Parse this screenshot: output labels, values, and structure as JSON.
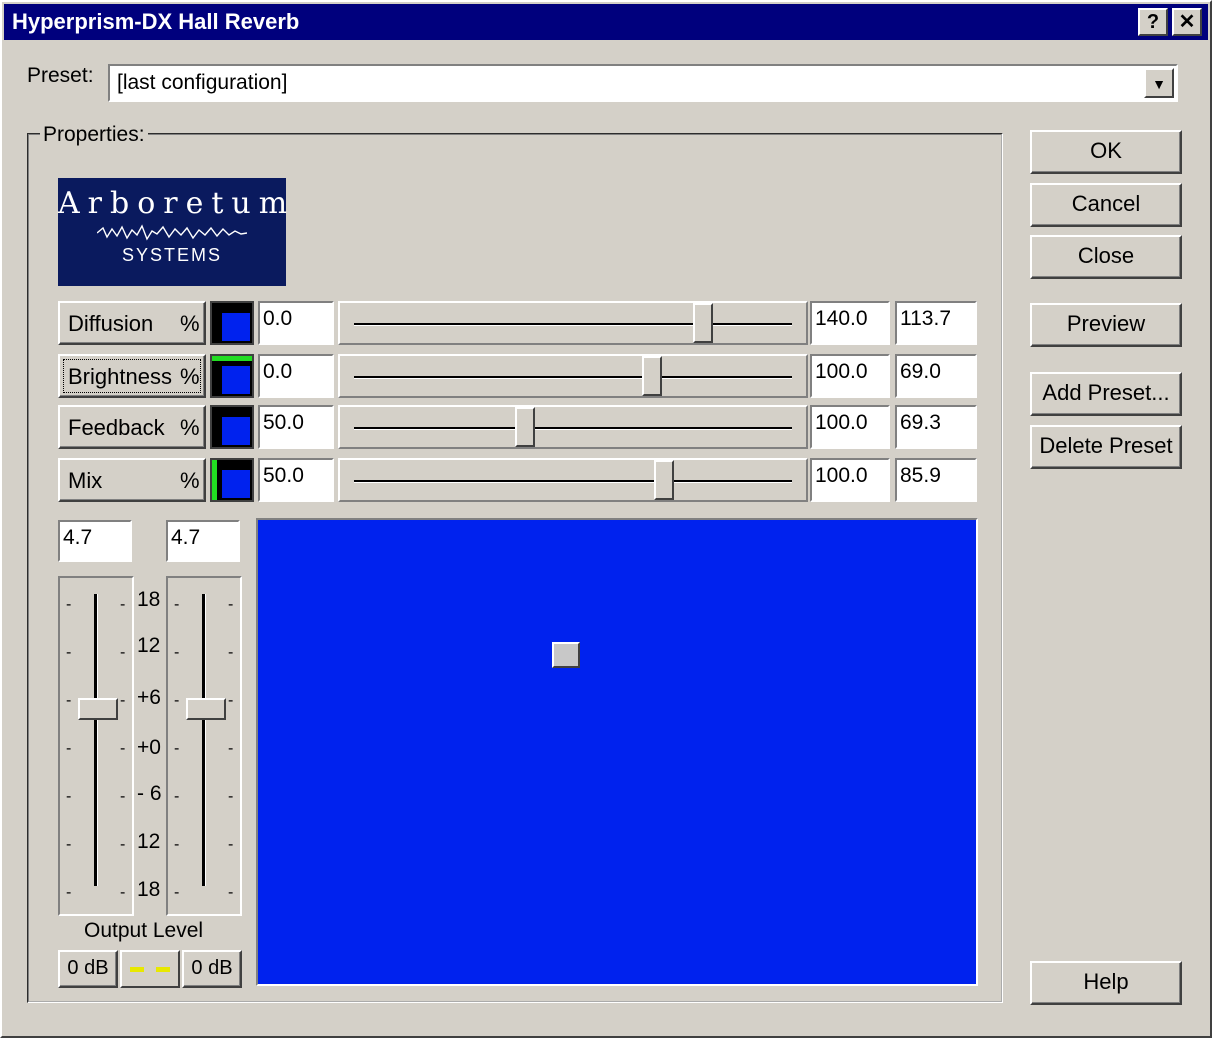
{
  "window": {
    "title": "Hyperprism-DX  Hall Reverb",
    "help_glyph": "?",
    "close_glyph": "✕"
  },
  "preset": {
    "label": "Preset:",
    "value": "[last configuration]"
  },
  "properties": {
    "label": "Properties:"
  },
  "logo": {
    "name": "Arboretum",
    "sub": "SYSTEMS"
  },
  "buttons": {
    "ok": "OK",
    "cancel": "Cancel",
    "close": "Close",
    "preview": "Preview",
    "add_preset": "Add Preset...",
    "delete_preset": "Delete Preset",
    "help": "Help"
  },
  "params": [
    {
      "name": "Diffusion",
      "unit": "%",
      "min": "0.0",
      "max": "140.0",
      "value": "113.7",
      "fraction": 0.81
    },
    {
      "name": "Brightness",
      "unit": "%",
      "min": "0.0",
      "max": "100.0",
      "value": "69.0",
      "fraction": 0.69
    },
    {
      "name": "Feedback",
      "unit": "%",
      "min": "50.0",
      "max": "100.0",
      "value": "69.3",
      "fraction": 0.386
    },
    {
      "name": "Mix",
      "unit": "%",
      "min": "50.0",
      "max": "100.0",
      "value": "85.9",
      "fraction": 0.718
    }
  ],
  "output": {
    "left_value": "4.7",
    "right_value": "4.7",
    "label": "Output Level",
    "left_db": "0 dB",
    "right_db": "0 dB",
    "scale": [
      "18",
      "12",
      "+6",
      "+0",
      "- 6",
      "12",
      "18"
    ]
  },
  "colors": {
    "accent": "#00007d",
    "pad": "#0022ee"
  }
}
